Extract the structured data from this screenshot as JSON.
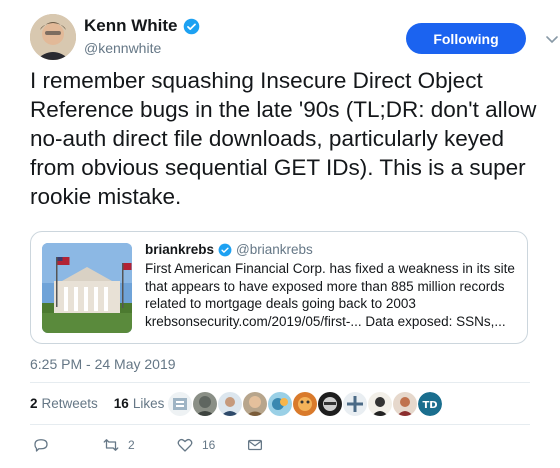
{
  "author": {
    "display_name": "Kenn White",
    "handle": "@kennwhite",
    "verified": true
  },
  "follow_button": "Following",
  "tweet_text": "I remember squashing Insecure Direct Object Reference bugs in the late '90s (TL;DR: don't allow no-auth direct file downloads, particularly keyed from obvious sequential GET IDs). This is a super rookie mistake.",
  "quoted": {
    "display_name": "briankrebs",
    "handle": "@briankrebs",
    "text": "First American Financial Corp. has fixed a weakness in its site that appears to have exposed more than 885 million records related to mortgage deals going back to 2003 krebsonsecurity.com/2019/05/first-... Data exposed: SSNs,..."
  },
  "timestamp": "6:25 PM - 24 May 2019",
  "stats": {
    "retweets_count": "2",
    "retweets_label": "Retweets",
    "likes_count": "16",
    "likes_label": "Likes"
  },
  "actions": {
    "reply_count": "",
    "retweet_count": "2",
    "like_count": "16"
  },
  "colors": {
    "accent": "#1b63f0",
    "verified": "#1da1f2",
    "secondary_text": "#657786"
  }
}
